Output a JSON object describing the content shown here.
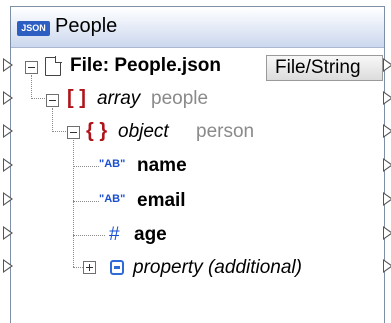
{
  "component": {
    "title": "People",
    "badge": "JSON"
  },
  "tree": {
    "file": {
      "label": "File: People.json",
      "button": "File/String"
    },
    "array": {
      "bracket": "[ ]",
      "keyword": "array",
      "name": "people"
    },
    "object": {
      "bracket": "{ }",
      "keyword": "object",
      "name": "person"
    },
    "fields": [
      {
        "icon": "AB",
        "name": "name"
      },
      {
        "icon": "AB",
        "name": "email"
      },
      {
        "icon": "#",
        "name": "age"
      }
    ],
    "property": {
      "label": "property (additional)"
    }
  }
}
